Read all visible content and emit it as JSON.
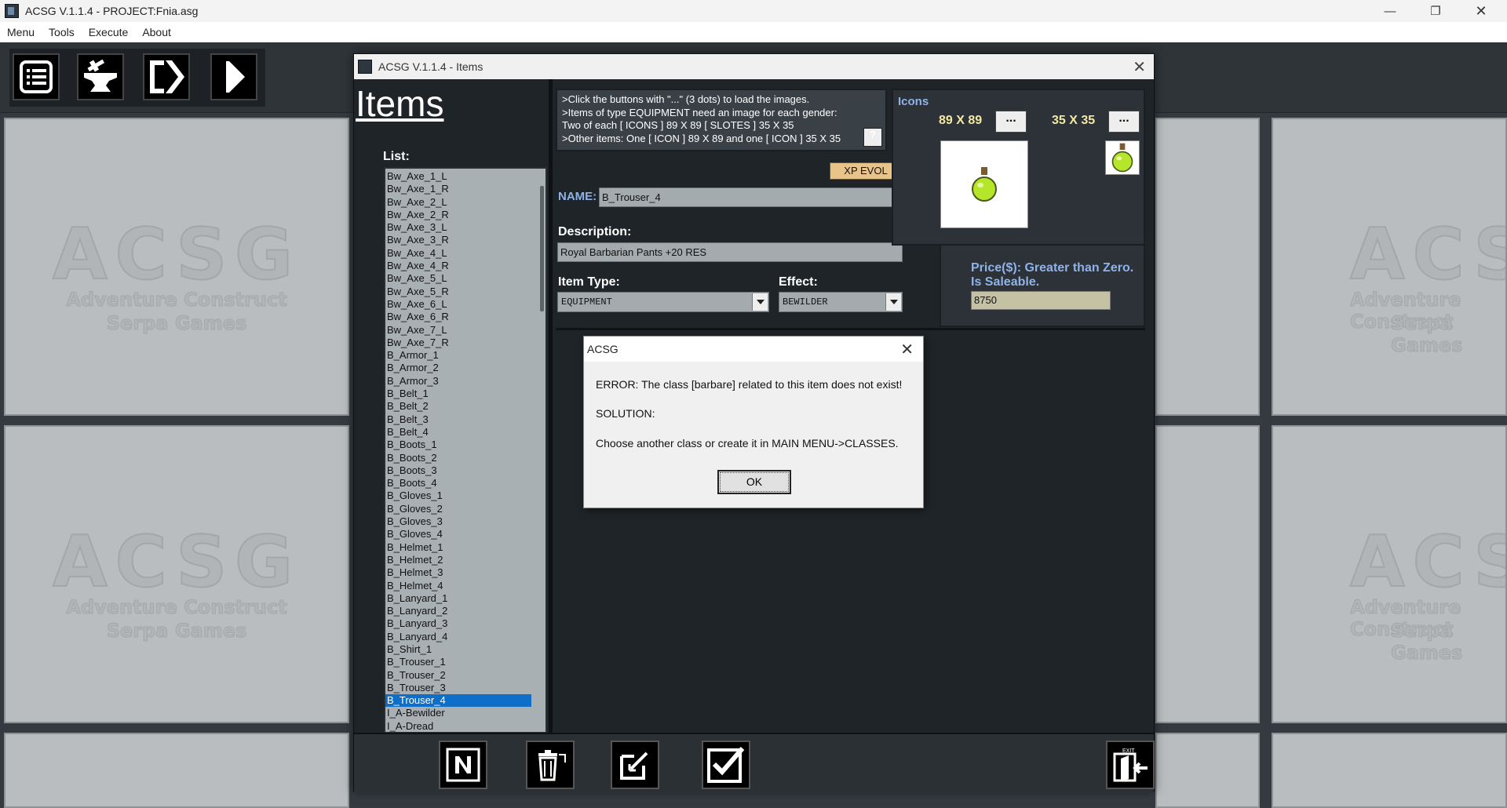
{
  "window": {
    "title": "ACSG V.1.1.4 - PROJECT:Fnia.asg"
  },
  "menubar": [
    "Menu",
    "Tools",
    "Execute",
    "About"
  ],
  "toolbar": {
    "icons": [
      "list-icon",
      "anvil-icon",
      "export-icon",
      "play-icon"
    ]
  },
  "watermark": {
    "big": "ACSG",
    "line1": "Adventure Construct",
    "line2": "Serpa Games"
  },
  "items_window": {
    "title": "ACSG V.1.1.4 - Items",
    "heading": "Items",
    "list_label": "List:",
    "list": [
      "Bw_Axe_1_L",
      "Bw_Axe_1_R",
      "Bw_Axe_2_L",
      "Bw_Axe_2_R",
      "Bw_Axe_3_L",
      "Bw_Axe_3_R",
      "Bw_Axe_4_L",
      "Bw_Axe_4_R",
      "Bw_Axe_5_L",
      "Bw_Axe_5_R",
      "Bw_Axe_6_L",
      "Bw_Axe_6_R",
      "Bw_Axe_7_L",
      "Bw_Axe_7_R",
      "B_Armor_1",
      "B_Armor_2",
      "B_Armor_3",
      "B_Belt_1",
      "B_Belt_2",
      "B_Belt_3",
      "B_Belt_4",
      "B_Boots_1",
      "B_Boots_2",
      "B_Boots_3",
      "B_Boots_4",
      "B_Gloves_1",
      "B_Gloves_2",
      "B_Gloves_3",
      "B_Gloves_4",
      "B_Helmet_1",
      "B_Helmet_2",
      "B_Helmet_3",
      "B_Helmet_4",
      "B_Lanyard_1",
      "B_Lanyard_2",
      "B_Lanyard_3",
      "B_Lanyard_4",
      "B_Shirt_1",
      "B_Trouser_1",
      "B_Trouser_2",
      "B_Trouser_3",
      "B_Trouser_4",
      "I_A-Bewilder",
      "I_A-Dread"
    ],
    "selected": "B_Trouser_4",
    "info": [
      ">Click the buttons with \"...\" (3 dots) to load the images.",
      ">Items of type EQUIPMENT need an image for each gender:",
      "Two of each [ ICONS ] 89 X 89 [ SLOTES ] 35 X 35",
      ">Other items: One [ ICON ] 89 X 89 and one [ ICON ] 35 X 35"
    ],
    "help": "?",
    "xp_evol": "XP EVOL",
    "name_label": "NAME:",
    "name_value": "B_Trouser_4",
    "desc_label": "Description:",
    "desc_value": "Royal Barbarian Pants +20 RES",
    "type_label": "Item Type:",
    "type_value": "EQUIPMENT",
    "effect_label": "Effect:",
    "effect_value": "BEWILDER",
    "icons_label": "Icons",
    "size_big": "89 X 89",
    "size_small": "35 X 35",
    "dots": "...",
    "price_label_1": "Price($): Greater than Zero.",
    "price_label_2": "Is Saleable.",
    "price_value": "8750",
    "bottom_icons": [
      "new-icon",
      "delete-icon",
      "edit-icon",
      "confirm-icon",
      "exit-icon"
    ],
    "exit_text": "EXIT"
  },
  "dialog": {
    "title": "ACSG",
    "error": "ERROR: The class [barbare] related to this item does not exist!",
    "solution": "SOLUTION:",
    "hint": "Choose another class or create it in MAIN MENU->CLASSES.",
    "ok": "OK"
  }
}
